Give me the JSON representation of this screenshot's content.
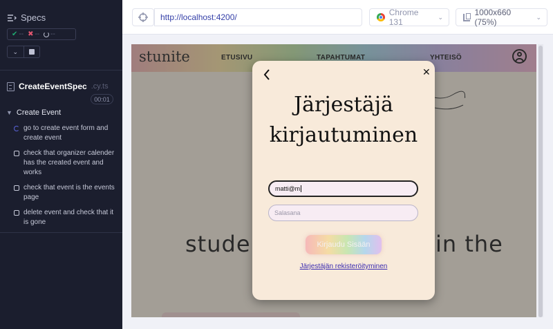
{
  "sidebar": {
    "specs_label": "Specs",
    "stats": {
      "passed": "--",
      "failed": "--",
      "pending": "--"
    },
    "spec_file": {
      "name": "CreateEventSpec",
      "ext": ".cy.ts"
    },
    "timer": "00:01",
    "suite": {
      "title": "Create Event"
    },
    "tests": [
      {
        "title": "go to create event form and create event",
        "state": "running"
      },
      {
        "title": "check that organizer calender has the created event and works",
        "state": "queued"
      },
      {
        "title": "check that event is the events page",
        "state": "queued"
      },
      {
        "title": "delete event and check that it is gone",
        "state": "queued"
      }
    ]
  },
  "browser": {
    "url": "http://localhost:4200/",
    "browser_label": "Chrome 131",
    "viewport_label": "1000x660 (75%)"
  },
  "app": {
    "logo": "stunite",
    "nav": [
      "ETUSIVU",
      "TAPAHTUMAT",
      "YHTEISÖ"
    ],
    "background_text_left": "studen",
    "background_text_right": "in the",
    "modal": {
      "title_line1": "Järjestäjä",
      "title_line2": "kirjautuminen",
      "email_value": "matti@m",
      "password_placeholder": "Salasana",
      "login_button": "Kirjaudu Sisään",
      "register_link": "Järjestäjän rekisteröityminen"
    }
  },
  "colors": {
    "sidebar_bg": "#1b1e2e",
    "pass": "#1fa971",
    "fail": "#e45770",
    "running": "#5a63d8",
    "url_text": "#3540a8",
    "modal_bg": "#f8eada",
    "link": "#3b2bb0"
  }
}
